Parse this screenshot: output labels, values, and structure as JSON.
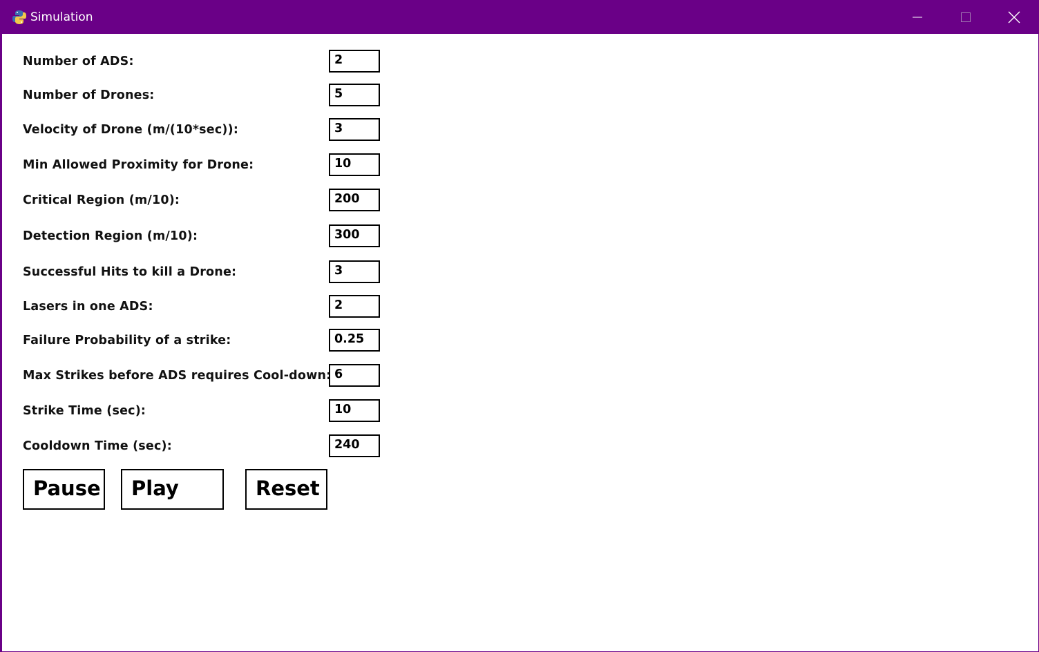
{
  "window": {
    "title": "Simulation",
    "app_icon": "python-icon",
    "controls": {
      "minimize": "minimize-icon",
      "maximize": "maximize-icon",
      "close": "close-icon"
    }
  },
  "fields": [
    {
      "label": "Number of ADS:",
      "value": "2"
    },
    {
      "label": "Number of Drones:",
      "value": "5"
    },
    {
      "label": "Velocity of Drone (m/(10*sec)):",
      "value": "3"
    },
    {
      "label": "Min Allowed Proximity for Drone:",
      "value": "10"
    },
    {
      "label": "Critical Region (m/10):",
      "value": "200"
    },
    {
      "label": "Detection Region (m/10):",
      "value": "300"
    },
    {
      "label": "Successful Hits to kill a Drone:",
      "value": "3"
    },
    {
      "label": "Lasers in one ADS:",
      "value": "2"
    },
    {
      "label": "Failure Probability of a strike:",
      "value": "0.25"
    },
    {
      "label": "Max Strikes before ADS requires Cool-down:",
      "value": "6"
    },
    {
      "label": "Strike Time (sec):",
      "value": "10"
    },
    {
      "label": "Cooldown Time (sec):",
      "value": "240"
    }
  ],
  "buttons": {
    "pause": "Pause",
    "play": "Play",
    "reset": "Reset"
  },
  "colors": {
    "titlebar": "#6a0087",
    "background": "#ffffff",
    "border": "#000000"
  }
}
